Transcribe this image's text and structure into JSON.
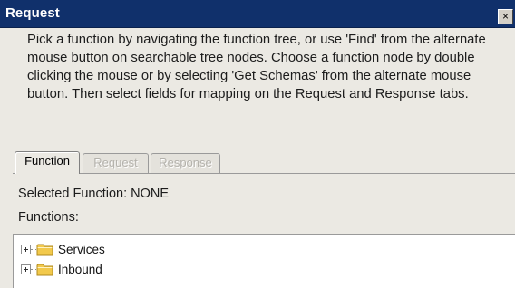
{
  "window": {
    "title": "Request",
    "close_label": "×"
  },
  "instructions": "Pick a function by navigating the function tree, or use 'Find' from the alternate mouse button on searchable tree nodes. Choose a function node by double clicking the mouse or by selecting 'Get Schemas' from the alternate mouse button. Then select fields for mapping on the Request and Response tabs.",
  "tabs": [
    {
      "label": "Function",
      "state": "active"
    },
    {
      "label": "Request",
      "state": "disabled"
    },
    {
      "label": "Response",
      "state": "disabled"
    }
  ],
  "selected_function": {
    "text": "Selected Function: NONE"
  },
  "functions": {
    "label": "Functions:",
    "tree": [
      {
        "label": "Services",
        "icon": "folder-icon",
        "expanded": false
      },
      {
        "label": "Inbound",
        "icon": "folder-icon",
        "expanded": false
      }
    ]
  },
  "colors": {
    "titlebar": "#10306b",
    "dialog_bg": "#ebe9e3",
    "folder": "#f2c94c"
  }
}
